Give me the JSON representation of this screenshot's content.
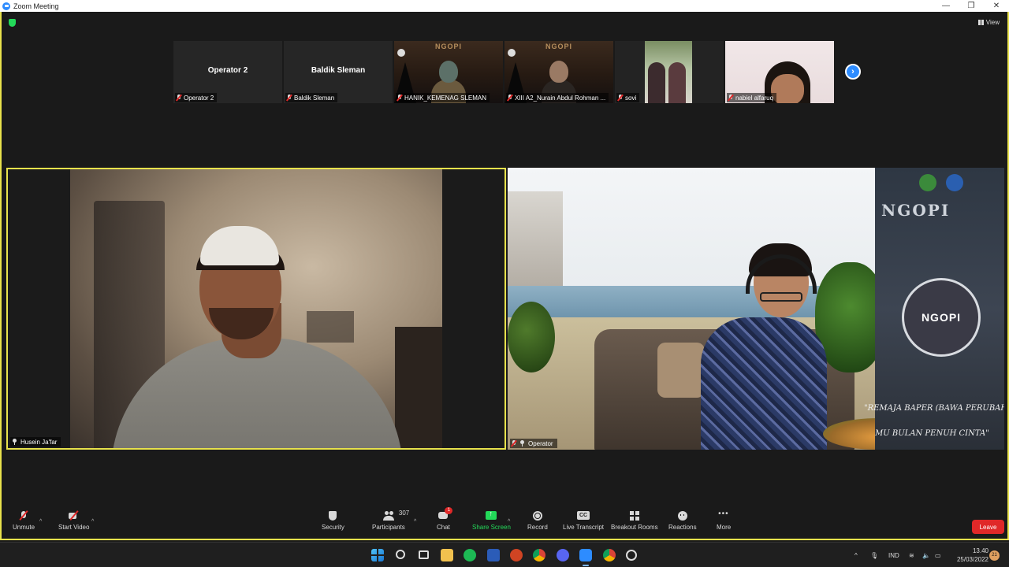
{
  "window": {
    "title": "Zoom Meeting",
    "controls": [
      "—",
      "❐",
      "✕"
    ]
  },
  "top_bar": {
    "view_label": "View"
  },
  "strip": {
    "tiles": [
      {
        "big_name": "Operator 2",
        "label": "Operator 2"
      },
      {
        "big_name": "Baldik Sleman",
        "label": "Baldik Sleman"
      },
      {
        "label": "HANIK_KEMENAG SLEMAN",
        "poster_text": "NGOPI"
      },
      {
        "label": "XIII A2_Nurain Abdul Rohman ...",
        "poster_text": "NGOPI"
      },
      {
        "label": "sovi"
      },
      {
        "label": "nabiel alfaruq"
      }
    ],
    "next_glyph": "›"
  },
  "videos": {
    "left": {
      "label": "Husein Ja'far"
    },
    "right": {
      "label": "Operator",
      "banner_title": "NGOPI",
      "logo_text": "NGOPI",
      "tagline_1": "\"REMAJA BAPER (BAWA PERUBAHA",
      "tagline_2": "MU BULAN PENUH CINTA\""
    }
  },
  "controls": {
    "unmute": "Unmute",
    "start_video": "Start Video",
    "security": "Security",
    "participants": "Participants",
    "participants_count": "307",
    "chat": "Chat",
    "chat_badge": "1",
    "share_screen": "Share Screen",
    "record": "Record",
    "live_transcript": "Live Transcript",
    "breakout_rooms": "Breakout Rooms",
    "reactions": "Reactions",
    "more": "More",
    "leave": "Leave",
    "caret": "^"
  },
  "taskbar": {
    "tray_caret": "^",
    "language": "IND",
    "time": "13.40",
    "date": "25/03/2022",
    "notification_count": "21"
  },
  "colors": {
    "accent_blue": "#2d8cff",
    "active_speaker": "#e8e24c",
    "share_green": "#23d959",
    "leave_red": "#e02828"
  }
}
